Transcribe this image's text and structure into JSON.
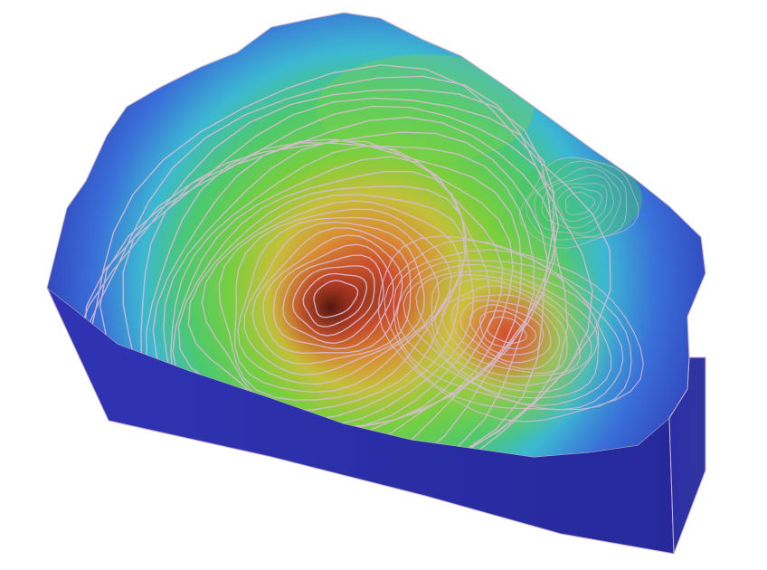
{
  "scene": {
    "subject": "3d-terrain-model",
    "colormap": [
      "#2b2fa8",
      "#3a63d8",
      "#3fb8d6",
      "#4fcf7a",
      "#7ed23f",
      "#c8c43a",
      "#d98a33",
      "#c9442a",
      "#5a1c12"
    ],
    "base_color": "#2b2fa0",
    "edge_color": "#c9b2c9",
    "background": "#ffffff"
  }
}
